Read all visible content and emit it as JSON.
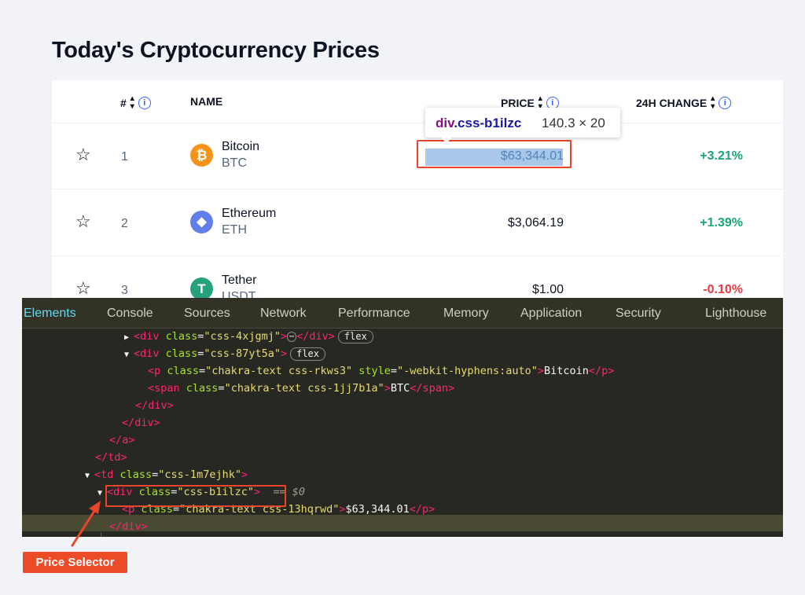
{
  "page_title": "Today's Cryptocurrency Prices",
  "table": {
    "headers": {
      "rank": "#",
      "name": "NAME",
      "price": "PRICE",
      "change": "24H CHANGE"
    },
    "rows": [
      {
        "rank": "1",
        "name": "Bitcoin",
        "symbol": "BTC",
        "price": "$63,344.01",
        "change": "+3.21%",
        "icon": "bitcoin-icon",
        "icon_color": "#f7931a",
        "icon_glyph": "₿",
        "trend": "up"
      },
      {
        "rank": "2",
        "name": "Ethereum",
        "symbol": "ETH",
        "price": "$3,064.19",
        "change": "+1.39%",
        "icon": "ethereum-icon",
        "icon_color": "#627eea",
        "icon_glyph": "◆",
        "trend": "up"
      },
      {
        "rank": "3",
        "name": "Tether",
        "symbol": "USDT",
        "price": "$1.00",
        "change": "-0.10%",
        "icon": "tether-icon",
        "icon_color": "#26a17b",
        "icon_glyph": "T",
        "trend": "down"
      }
    ]
  },
  "tooltip": {
    "tag": "div",
    "class": ".css-b1ilzc",
    "size": "140.3 × 20"
  },
  "devtools": {
    "tabs": [
      "Elements",
      "Console",
      "Sources",
      "Network",
      "Performance",
      "Memory",
      "Application",
      "Security",
      "Lighthouse"
    ],
    "active_tab": "Elements",
    "lines": {
      "l1_class": "\"css-4xjgmj\"",
      "l2_class": "\"css-87yt5a\"",
      "l3_class": "\"chakra-text css-rkws3\"",
      "l3_style": "\"-webkit-hyphens:auto\"",
      "l3_text": "Bitcoin",
      "l4_class": "\"chakra-text css-1jj7b1a\"",
      "l4_text": "BTC",
      "l8_class": "\"css-1m7ejhk\"",
      "l9_class": "\"css-b1ilzc\"",
      "l9_ref": "== $0",
      "l10_class": "\"chakra-text css-13hqrwd\"",
      "l10_text": "$63,344.01"
    },
    "badge_flex": "flex",
    "badge_dots": "⋯"
  },
  "annotation": {
    "label": "Price Selector",
    "color": "#ec4b27"
  }
}
